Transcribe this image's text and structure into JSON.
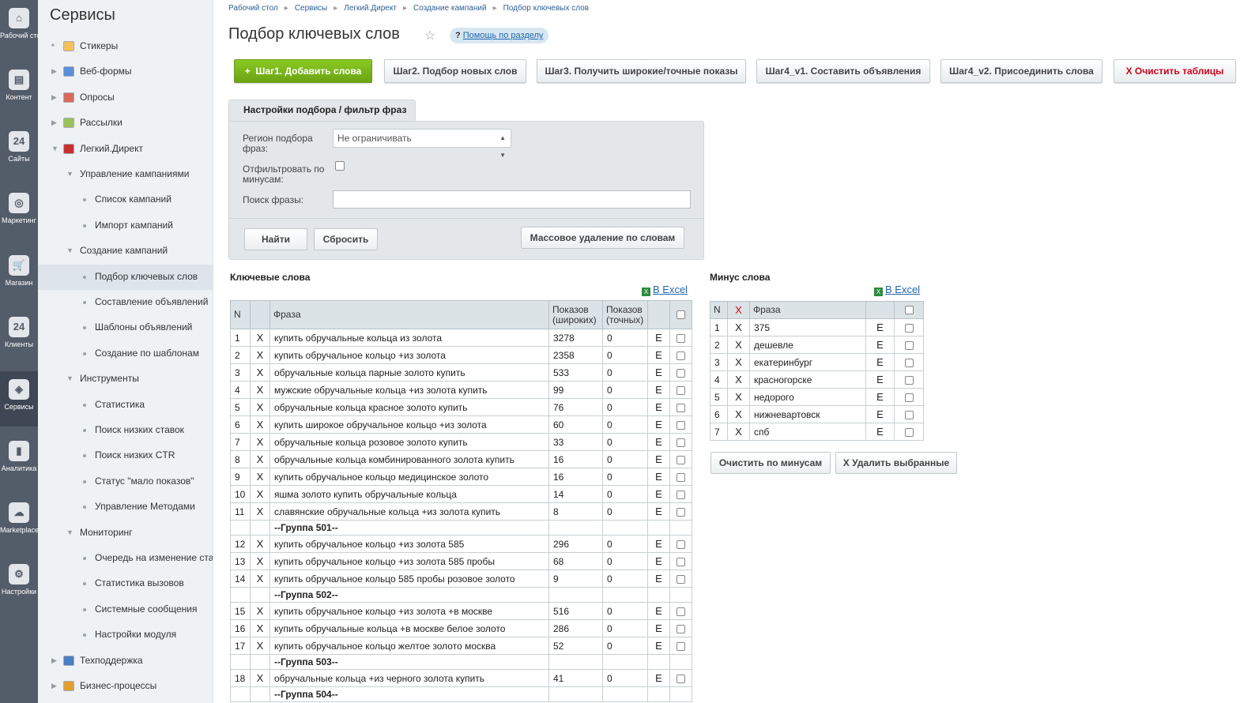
{
  "rail": [
    {
      "icon": "home-icon",
      "label": "Рабочий стол",
      "glyph": "⌂"
    },
    {
      "icon": "content-icon",
      "label": "Контент",
      "glyph": "▤"
    },
    {
      "icon": "sites-icon",
      "label": "Сайты",
      "glyph": "24"
    },
    {
      "icon": "target-icon",
      "label": "Маркетинг",
      "glyph": "◎"
    },
    {
      "icon": "cart-icon",
      "label": "Магазин",
      "glyph": "🛒"
    },
    {
      "icon": "clients-icon",
      "label": "Клиенты",
      "glyph": "24"
    },
    {
      "icon": "layers-icon",
      "label": "Сервисы",
      "glyph": "◈"
    },
    {
      "icon": "chart-icon",
      "label": "Аналитика",
      "glyph": "▮"
    },
    {
      "icon": "cloud-icon",
      "label": "Marketplace",
      "glyph": "☁"
    },
    {
      "icon": "gear-icon",
      "label": "Настройки",
      "glyph": "⚙"
    }
  ],
  "sidebar": {
    "title": "Сервисы",
    "items": [
      {
        "label": "Стикеры",
        "arrow": "■",
        "icon": "stickers-icon"
      },
      {
        "label": "Веб-формы",
        "arrow": "▶",
        "icon": "webforms-icon"
      },
      {
        "label": "Опросы",
        "arrow": "▶",
        "icon": "polls-icon"
      },
      {
        "label": "Рассылки",
        "arrow": "▶",
        "icon": "mailing-icon"
      },
      {
        "label": "Легкий.Директ",
        "arrow": "▼",
        "icon": "direct-icon"
      },
      {
        "label": "Управление кампаниями",
        "arrow": "▼"
      },
      {
        "label": "Список кампаний"
      },
      {
        "label": "Импорт кампаний"
      },
      {
        "label": "Создание кампаний",
        "arrow": "▼"
      },
      {
        "label": "Подбор ключевых слов"
      },
      {
        "label": "Составление объявлений"
      },
      {
        "label": "Шаблоны объявлений"
      },
      {
        "label": "Создание по шаблонам"
      },
      {
        "label": "Инструменты",
        "arrow": "▼"
      },
      {
        "label": "Статистика"
      },
      {
        "label": "Поиск низких ставок"
      },
      {
        "label": "Поиск низких CTR"
      },
      {
        "label": "Статус \"мало показов\""
      },
      {
        "label": "Управление Методами"
      },
      {
        "label": "Мониторинг",
        "arrow": "▼"
      },
      {
        "label": "Очередь на изменение ставок"
      },
      {
        "label": "Статистика вызовов"
      },
      {
        "label": "Системные сообщения"
      },
      {
        "label": "Настройки модуля"
      },
      {
        "label": "Техподдержка",
        "arrow": "▶",
        "icon": "support-icon"
      },
      {
        "label": "Бизнес-процессы",
        "arrow": "▶",
        "icon": "bizproc-icon"
      }
    ]
  },
  "breadcrumbs": [
    "Рабочий стол",
    "Сервисы",
    "Легкий.Директ",
    "Создание кампаний",
    "Подбор ключевых слов"
  ],
  "page": {
    "title": "Подбор ключевых слов",
    "help_q": "?",
    "help_label": "Помощь по разделу"
  },
  "steps": {
    "step1": "Шаг1. Добавить слова",
    "step1_plus": "+",
    "step2": "Шаг2. Подбор новых слов",
    "step3": "Шаг3. Получить широкие/точные показы",
    "step4v1": "Шаг4_v1. Составить объявления",
    "step4v2": "Шаг4_v2. Присоединить слова",
    "clear": "X Очистить таблицы"
  },
  "filter": {
    "tab": "Настройки подбора / фильтр фраз",
    "region_label": "Регион подбора фраз:",
    "region_value": "Не ограничивать",
    "minus_label": "Отфильтровать по минусам:",
    "search_label": "Поиск фразы:",
    "search_value": "",
    "find_btn": "Найти",
    "reset_btn": "Сбросить",
    "mass_delete_btn": "Массовое удаление по словам"
  },
  "keywords": {
    "title": "Ключевые слова",
    "excel": "В Excel",
    "headers": {
      "n": "N",
      "x": "X",
      "phrase": "Фраза",
      "broad": "Показов (широких)",
      "exact": "Показов (точных)"
    },
    "rows": [
      {
        "n": "1",
        "phrase": "купить обручальные кольца из золота",
        "broad": "3278",
        "exact": "0"
      },
      {
        "n": "2",
        "phrase": "купить обручальное кольцо +из золота",
        "broad": "2358",
        "exact": "0"
      },
      {
        "n": "3",
        "phrase": "обручальные кольца парные золото купить",
        "broad": "533",
        "exact": "0"
      },
      {
        "n": "4",
        "phrase": "мужские обручальные кольца +из золота купить",
        "broad": "99",
        "exact": "0"
      },
      {
        "n": "5",
        "phrase": "обручальные кольца красное золото купить",
        "broad": "76",
        "exact": "0"
      },
      {
        "n": "6",
        "phrase": "купить широкое обручальное кольцо +из золота",
        "broad": "60",
        "exact": "0"
      },
      {
        "n": "7",
        "phrase": "обручальные кольца розовое золото купить",
        "broad": "33",
        "exact": "0"
      },
      {
        "n": "8",
        "phrase": "обручальные кольца комбинированного золота купить",
        "broad": "16",
        "exact": "0"
      },
      {
        "n": "9",
        "phrase": "купить обручальное кольцо медицинское золото",
        "broad": "16",
        "exact": "0"
      },
      {
        "n": "10",
        "phrase": "яшма золото купить обручальные кольца",
        "broad": "14",
        "exact": "0"
      },
      {
        "n": "11",
        "phrase": "славянские обручальные кольца +из золота купить",
        "broad": "8",
        "exact": "0"
      },
      {
        "group": "--Группа 501--"
      },
      {
        "n": "12",
        "phrase": "купить обручальное кольцо +из золота 585",
        "broad": "296",
        "exact": "0"
      },
      {
        "n": "13",
        "phrase": "купить обручальное кольцо +из золота 585 пробы",
        "broad": "68",
        "exact": "0"
      },
      {
        "n": "14",
        "phrase": "купить обручальное кольцо 585 пробы розовое золото",
        "broad": "9",
        "exact": "0"
      },
      {
        "group": "--Группа 502--"
      },
      {
        "n": "15",
        "phrase": "купить обручальное кольцо +из золота +в москве",
        "broad": "516",
        "exact": "0"
      },
      {
        "n": "16",
        "phrase": "купить обручальные кольца +в москве белое золото",
        "broad": "286",
        "exact": "0"
      },
      {
        "n": "17",
        "phrase": "купить обручальное кольцо желтое золото москва",
        "broad": "52",
        "exact": "0"
      },
      {
        "group": "--Группа 503--"
      },
      {
        "n": "18",
        "phrase": "обручальные кольца +из черного золота купить",
        "broad": "41",
        "exact": "0"
      },
      {
        "group": "--Группа 504--"
      }
    ]
  },
  "minus": {
    "title": "Минус слова",
    "excel": "В Excel",
    "headers": {
      "n": "N",
      "x": "X",
      "phrase": "Фраза"
    },
    "rows": [
      {
        "n": "1",
        "phrase": "375"
      },
      {
        "n": "2",
        "phrase": "дешевле"
      },
      {
        "n": "3",
        "phrase": "екатеринбург"
      },
      {
        "n": "4",
        "phrase": "красногорске"
      },
      {
        "n": "5",
        "phrase": "недорого"
      },
      {
        "n": "6",
        "phrase": "нижневартовск"
      },
      {
        "n": "7",
        "phrase": "спб"
      }
    ],
    "clear_btn": "Очистить по минусам",
    "delete_btn": "X Удалить выбранные"
  },
  "row_labels": {
    "x": "X",
    "e": "E"
  },
  "colors": {
    "accent_green": "#7bb81d",
    "danger_red": "#d0021b",
    "link_blue": "#2067b0",
    "rail_bg": "#535c69"
  }
}
